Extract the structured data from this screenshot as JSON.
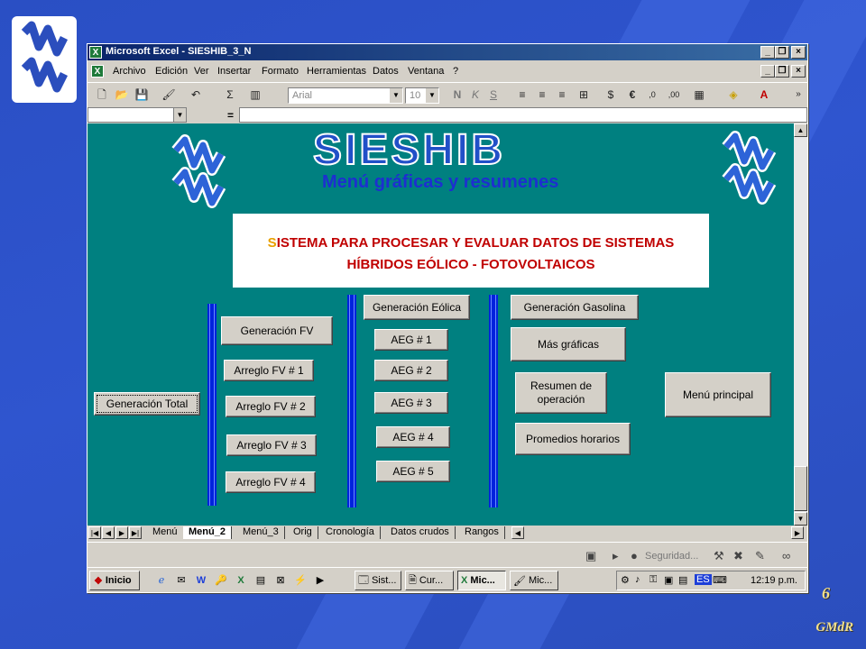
{
  "window": {
    "title": "Microsoft Excel - SIESHIB_3_N",
    "app_icon": "excel-icon"
  },
  "menu": [
    "Archivo",
    "Edición",
    "Ver",
    "Insertar",
    "Formato",
    "Herramientas",
    "Datos",
    "Ventana",
    "?"
  ],
  "toolbar": {
    "font": "Arial",
    "size": "10"
  },
  "formula": {
    "equals": "="
  },
  "sheet": {
    "title": "SIESHIB",
    "subtitle": "Menú gráficas y resumenes",
    "description_first_letter": "S",
    "description_line1_rest": "ISTEMA PARA PROCESAR Y EVALUAR DATOS DE SISTEMAS",
    "description_line2": "HÍBRIDOS EÓLICO - FOTOVOLTAICOS",
    "buttons": {
      "generacion_total": "Generación Total",
      "generacion_fv": "Generación FV",
      "arreglo_fv1": "Arreglo FV # 1",
      "arreglo_fv2": "Arreglo FV # 2",
      "arreglo_fv3": "Arreglo FV # 3",
      "arreglo_fv4": "Arreglo FV # 4",
      "generacion_eolica": "Generación Eólica",
      "aeg1": "AEG # 1",
      "aeg2": "AEG # 2",
      "aeg3": "AEG # 3",
      "aeg4": "AEG # 4",
      "aeg5": "AEG # 5",
      "generacion_gasolina": "Generación Gasolina",
      "mas_graficas": "Más gráficas",
      "resumen_operacion": "Resumen de operación",
      "promedios_horarios": "Promedios horarios",
      "menu_principal": "Menú principal"
    }
  },
  "tabs": [
    "Menú",
    "Menú_2",
    "Menú_3",
    "Orig",
    "Cronología",
    "Datos crudos",
    "Rangos"
  ],
  "active_tab": "Menú_2",
  "drawbar": {
    "security": "Seguridad..."
  },
  "taskbar": {
    "start": "Inicio",
    "tasks": [
      "Sist...",
      "Cur...",
      "Mic...",
      "Mic..."
    ],
    "language": "ES",
    "clock": "12:19 p.m."
  },
  "slide": {
    "page_number": "6",
    "footer": "GMdR"
  },
  "colors": {
    "sheet_bg": "#008080",
    "title_blue": "#2150c8",
    "desc_red": "#c00000",
    "slide_bg": "#2f55cf"
  }
}
